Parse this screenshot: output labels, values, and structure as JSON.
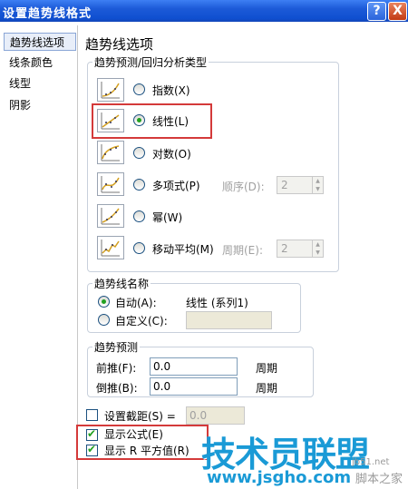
{
  "window": {
    "title": "设置趋势线格式",
    "help_label": "?",
    "close_label": "X"
  },
  "sidebar": {
    "items": [
      {
        "label": "趋势线选项",
        "selected": true
      },
      {
        "label": "线条颜色",
        "selected": false
      },
      {
        "label": "线型",
        "selected": false
      },
      {
        "label": "阴影",
        "selected": false
      }
    ]
  },
  "main": {
    "heading": "趋势线选项",
    "type_group": {
      "title": "趋势预测/回归分析类型",
      "options": [
        {
          "label": "指数(X)",
          "icon": "exponential-trend-icon",
          "checked": false
        },
        {
          "label": "线性(L)",
          "icon": "linear-trend-icon",
          "checked": true
        },
        {
          "label": "对数(O)",
          "icon": "logarithmic-trend-icon",
          "checked": false
        },
        {
          "label": "多项式(P)",
          "icon": "polynomial-trend-icon",
          "checked": false
        },
        {
          "label": "幂(W)",
          "icon": "power-trend-icon",
          "checked": false
        },
        {
          "label": "移动平均(M)",
          "icon": "moving-average-icon",
          "checked": false
        }
      ],
      "order_label": "顺序(D):",
      "order_value": "2",
      "period_label": "周期(E):",
      "period_value": "2"
    },
    "name_group": {
      "title": "趋势线名称",
      "auto_label": "自动(A):",
      "auto_value": "线性 (系列1)",
      "custom_label": "自定义(C):",
      "custom_value": ""
    },
    "forecast_group": {
      "title": "趋势预测",
      "forward_label": "前推(F):",
      "forward_value": "0.0",
      "forward_unit": "周期",
      "backward_label": "倒推(B):",
      "backward_value": "0.0",
      "backward_unit": "周期"
    },
    "intercept": {
      "label": "设置截距(S) =",
      "value": "0.0",
      "checked": false
    },
    "show_equation": {
      "label": "显示公式(E)",
      "checked": true
    },
    "show_r2": {
      "label": "显示 R 平方值(R)",
      "checked": true
    }
  },
  "watermark": {
    "main": "技术员联盟",
    "url": "www.jsgho.com",
    "small1": "jb51.net",
    "small2": "脚本之家"
  },
  "colors": {
    "title_bar": "#0f4fd0",
    "highlight_box": "#d43a3a",
    "watermark": "#1a9ad6"
  }
}
